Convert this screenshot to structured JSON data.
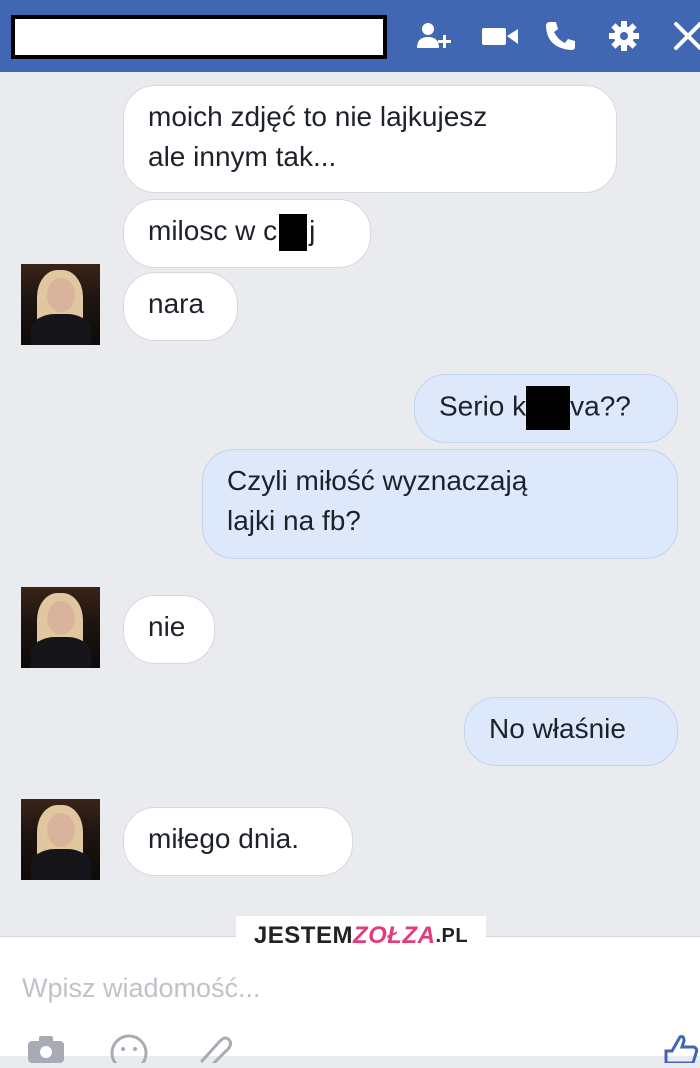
{
  "header": {
    "name_redacted": "",
    "icons": [
      "add-people-icon",
      "video-camera-icon",
      "phone-icon",
      "gear-icon",
      "close-icon"
    ],
    "color": "#4267b2"
  },
  "messages": [
    {
      "side": "in",
      "lines": [
        "moich zdjęć to nie lajkujesz",
        "ale innym tak..."
      ]
    },
    {
      "side": "in",
      "pre": "milosc w c",
      "post": "j"
    },
    {
      "side": "in",
      "text": "nara"
    },
    {
      "side": "out",
      "pre": "Serio k",
      "post": "va??"
    },
    {
      "side": "out",
      "lines": [
        "Czyli miłość wyznaczają",
        "lajki na fb?"
      ]
    },
    {
      "side": "in",
      "text": "nie"
    },
    {
      "side": "out",
      "text": "No właśnie"
    },
    {
      "side": "in",
      "text": "miłego dnia."
    }
  ],
  "watermark": {
    "part1": "JESTEM",
    "part2": "ZOŁZA",
    "part3": ".PL"
  },
  "composer": {
    "placeholder": "Wpisz wiadomość...",
    "icons": [
      "camera-icon",
      "emoji-icon",
      "paperclip-icon",
      "like-icon"
    ]
  }
}
